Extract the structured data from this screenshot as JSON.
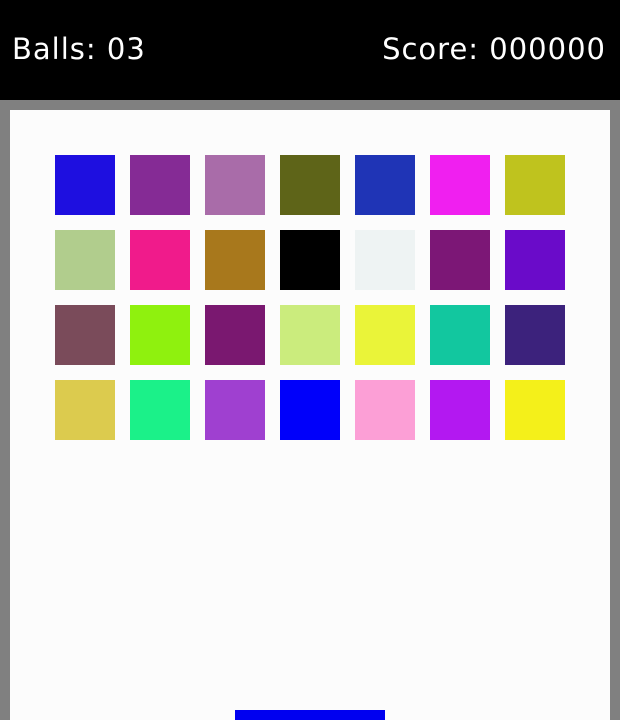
{
  "hud": {
    "balls_label": "Balls:",
    "balls_value": "03",
    "score_label": "Score:",
    "score_value": "000000"
  },
  "bricks": [
    [
      "#1e0fe0",
      "#852b95",
      "#a96ca9",
      "#5e6418",
      "#1f34b6",
      "#f01ff0",
      "#bfc31e"
    ],
    [
      "#b1cd8d",
      "#f01b8b",
      "#a8781c",
      "#000000",
      "#eef3f3",
      "#7c1776",
      "#6a0bc9"
    ],
    [
      "#7a4b5a",
      "#8ff10e",
      "#7a1870",
      "#cbec7d",
      "#eaf439",
      "#12c79f",
      "#3c227c"
    ],
    [
      "#dccb4e",
      "#1bf189",
      "#9f40d0",
      "#0000fa",
      "#fc9fd6",
      "#b318f1",
      "#f4f01a"
    ]
  ],
  "paddle": {
    "color": "#0000f0"
  }
}
